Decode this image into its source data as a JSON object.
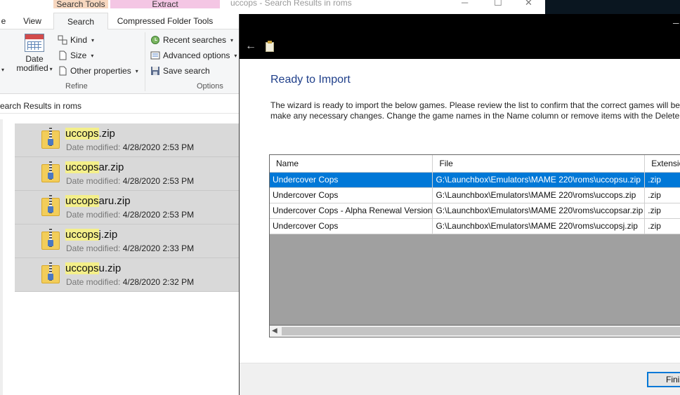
{
  "explorer": {
    "window_title": "uccops - Search Results in roms",
    "context_tabs": {
      "search_tools": "Search Tools",
      "extract": "Extract"
    },
    "ribbon_tabs": [
      "e",
      "View",
      "Search",
      "Compressed Folder Tools"
    ],
    "refine": {
      "date_modified": "Date modified",
      "kind": "Kind",
      "size": "Size",
      "other_properties": "Other properties",
      "group_label": "Refine"
    },
    "options": {
      "recent_searches": "Recent searches",
      "advanced_options": "Advanced options",
      "save_search": "Save search",
      "group_label": "Options"
    },
    "address": "earch Results in roms",
    "search_highlight": "uccops",
    "files": [
      {
        "highlight": "uccops",
        "rest": ".zip",
        "meta_label": "Date modified:",
        "date": "4/28/2020 2:53 PM"
      },
      {
        "highlight": "uccops",
        "rest": "ar.zip",
        "meta_label": "Date modified:",
        "date": "4/28/2020 2:53 PM"
      },
      {
        "highlight": "uccops",
        "rest": "aru.zip",
        "meta_label": "Date modified:",
        "date": "4/28/2020 2:53 PM"
      },
      {
        "highlight": "uccops",
        "rest": "j.zip",
        "meta_label": "Date modified:",
        "date": "4/28/2020 2:33 PM"
      },
      {
        "highlight": "uccops",
        "rest": "u.zip",
        "meta_label": "Date modified:",
        "date": "4/28/2020 2:32 PM"
      }
    ]
  },
  "wizard": {
    "title": "Ready to Import",
    "description_line1": "The wizard is ready to import the below games. Please review the list to confirm that the correct games will be i",
    "description_line2": "make any necessary changes. Change the game names in the Name column or remove items with the Delete ke",
    "columns": [
      "Name",
      "File",
      "Extensio"
    ],
    "rows": [
      {
        "name": "Undercover Cops",
        "file": "G:\\Launchbox\\Emulators\\MAME 220\\roms\\uccopsu.zip",
        "ext": ".zip",
        "selected": true
      },
      {
        "name": "Undercover Cops",
        "file": "G:\\Launchbox\\Emulators\\MAME 220\\roms\\uccops.zip",
        "ext": ".zip",
        "selected": false
      },
      {
        "name": "Undercover Cops - Alpha Renewal Version",
        "file": "G:\\Launchbox\\Emulators\\MAME 220\\roms\\uccopsar.zip",
        "ext": ".zip",
        "selected": false
      },
      {
        "name": "Undercover Cops",
        "file": "G:\\Launchbox\\Emulators\\MAME 220\\roms\\uccopsj.zip",
        "ext": ".zip",
        "selected": false
      }
    ],
    "finish_label": "Finish"
  },
  "colors": {
    "selection": "#0078d7",
    "wizard_title": "#1f3f8a",
    "search_highlight": "#f4ef8a",
    "file_row_bg": "#d9d9d9"
  }
}
